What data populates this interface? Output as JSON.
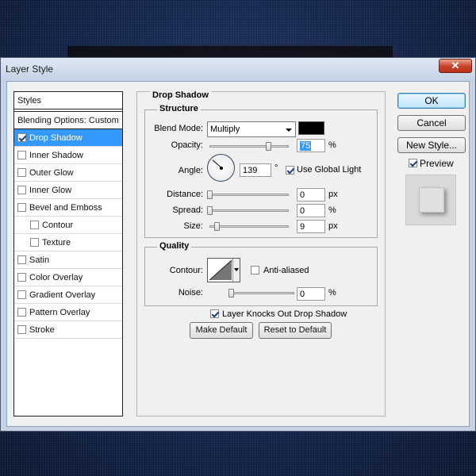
{
  "window": {
    "title": "Layer Style",
    "close_glyph": "✕"
  },
  "styles_list": {
    "header": "Styles",
    "blending": "Blending Options: Custom",
    "items": [
      {
        "label": "Drop Shadow",
        "checked": true,
        "selected": true
      },
      {
        "label": "Inner Shadow",
        "checked": false
      },
      {
        "label": "Outer Glow",
        "checked": false
      },
      {
        "label": "Inner Glow",
        "checked": false
      },
      {
        "label": "Bevel and Emboss",
        "checked": false
      },
      {
        "label": "Contour",
        "checked": false
      },
      {
        "label": "Texture",
        "checked": false
      },
      {
        "label": "Satin",
        "checked": false
      },
      {
        "label": "Color Overlay",
        "checked": false
      },
      {
        "label": "Gradient Overlay",
        "checked": false
      },
      {
        "label": "Pattern Overlay",
        "checked": false
      },
      {
        "label": "Stroke",
        "checked": false
      }
    ]
  },
  "drop_shadow": {
    "title": "Drop Shadow",
    "structure": {
      "title": "Structure",
      "blend_mode_label": "Blend Mode:",
      "blend_mode_value": "Multiply",
      "shadow_color": "#000000",
      "opacity_label": "Opacity:",
      "opacity_value": "75",
      "opacity_unit": "%",
      "angle_label": "Angle:",
      "angle_value": "139",
      "angle_unit": "°",
      "use_global_light_label": "Use Global Light",
      "use_global_light": true,
      "distance_label": "Distance:",
      "distance_value": "0",
      "distance_unit": "px",
      "spread_label": "Spread:",
      "spread_value": "0",
      "spread_unit": "%",
      "size_label": "Size:",
      "size_value": "9",
      "size_unit": "px"
    },
    "quality": {
      "title": "Quality",
      "contour_label": "Contour:",
      "anti_aliased_label": "Anti-aliased",
      "anti_aliased": false,
      "noise_label": "Noise:",
      "noise_value": "0",
      "noise_unit": "%"
    },
    "knocks_out_label": "Layer Knocks Out Drop Shadow",
    "knocks_out": true,
    "make_default_label": "Make Default",
    "reset_default_label": "Reset to Default"
  },
  "sliders": {
    "opacity": 0.75,
    "distance": 0.0,
    "spread": 0.0,
    "size": 0.09,
    "noise": 0.0
  },
  "buttons": {
    "ok": "OK",
    "cancel": "Cancel",
    "new_style": "New Style..."
  },
  "preview": {
    "label": "Preview",
    "checked": true
  }
}
